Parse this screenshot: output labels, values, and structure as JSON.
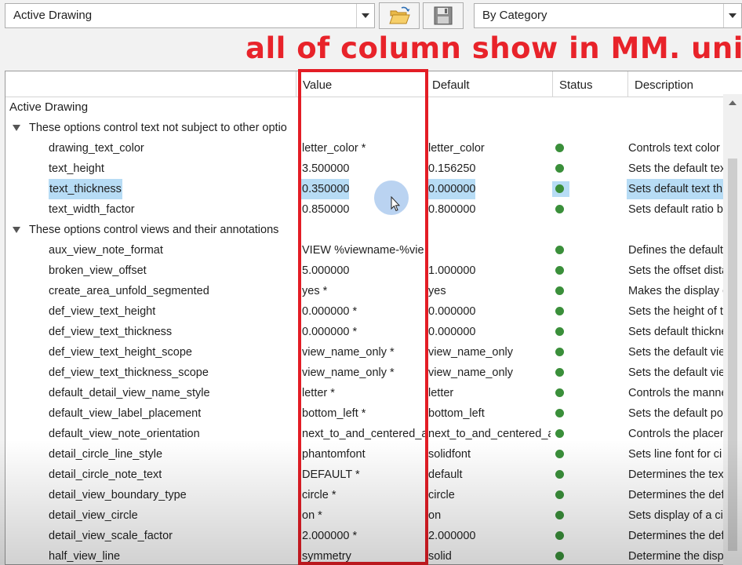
{
  "toolbar": {
    "drawing_select": "Active Drawing",
    "open_icon": "folder-open-icon",
    "save_icon": "save-icon",
    "filter_select": "By Category"
  },
  "annotation": "all of column show in MM. unit",
  "columns": {
    "value": "Value",
    "default": "Default",
    "status": "Status",
    "description": "Description"
  },
  "group_title": "Active Drawing",
  "colors": {
    "annotation": "#e8232a",
    "status_ok": "#3a8f3a",
    "selection": "#b7dcf5"
  },
  "rows": [
    {
      "kind": "category",
      "name": "These options control text not subject to other optio"
    },
    {
      "kind": "option",
      "name": "drawing_text_color",
      "value": "letter_color *",
      "default": "letter_color",
      "status": "ok",
      "description": "Controls text color"
    },
    {
      "kind": "option",
      "name": "text_height",
      "value": "3.500000",
      "default": "0.156250",
      "status": "ok",
      "description": "Sets the default tex"
    },
    {
      "kind": "option",
      "name": "text_thickness",
      "value": "0.350000",
      "default": "0.000000",
      "status": "ok",
      "description": "Sets default text th",
      "selected": true
    },
    {
      "kind": "option",
      "name": "text_width_factor",
      "value": "0.850000",
      "default": "0.800000",
      "status": "ok",
      "description": "Sets default ratio b"
    },
    {
      "kind": "category",
      "name": "These options control views and their annotations"
    },
    {
      "kind": "option",
      "name": "aux_view_note_format",
      "value": "VIEW %viewname-%vie",
      "default": "",
      "status": "ok",
      "description": "Defines the default"
    },
    {
      "kind": "option",
      "name": "broken_view_offset",
      "value": "5.000000",
      "default": "1.000000",
      "status": "ok",
      "description": "Sets the offset dista"
    },
    {
      "kind": "option",
      "name": "create_area_unfold_segmented",
      "value": "yes *",
      "default": "yes",
      "status": "ok",
      "description": "Makes the display o"
    },
    {
      "kind": "option",
      "name": "def_view_text_height",
      "value": "0.000000 *",
      "default": "0.000000",
      "status": "ok",
      "description": "Sets the height of t"
    },
    {
      "kind": "option",
      "name": "def_view_text_thickness",
      "value": "0.000000 *",
      "default": "0.000000",
      "status": "ok",
      "description": "Sets default thickne"
    },
    {
      "kind": "option",
      "name": "def_view_text_height_scope",
      "value": "view_name_only *",
      "default": "view_name_only",
      "status": "ok",
      "description": "Sets the default vie"
    },
    {
      "kind": "option",
      "name": "def_view_text_thickness_scope",
      "value": "view_name_only *",
      "default": "view_name_only",
      "status": "ok",
      "description": "Sets the default vie"
    },
    {
      "kind": "option",
      "name": "default_detail_view_name_style",
      "value": "letter *",
      "default": "letter",
      "status": "ok",
      "description": "Controls the manne"
    },
    {
      "kind": "option",
      "name": "default_view_label_placement",
      "value": "bottom_left *",
      "default": "bottom_left",
      "status": "ok",
      "description": "Sets the default po"
    },
    {
      "kind": "option",
      "name": "default_view_note_orientation",
      "value": "next_to_and_centered_a",
      "default": "next_to_and_centered_a",
      "status": "ok",
      "description": "Controls the placem"
    },
    {
      "kind": "option",
      "name": "detail_circle_line_style",
      "value": "phantomfont",
      "default": "solidfont",
      "status": "ok",
      "description": "Sets line font for ci"
    },
    {
      "kind": "option",
      "name": "detail_circle_note_text",
      "value": "DEFAULT *",
      "default": "default",
      "status": "ok",
      "description": "Determines the tex"
    },
    {
      "kind": "option",
      "name": "detail_view_boundary_type",
      "value": "circle *",
      "default": "circle",
      "status": "ok",
      "description": "Determines the def"
    },
    {
      "kind": "option",
      "name": "detail_view_circle",
      "value": "on *",
      "default": "on",
      "status": "ok",
      "description": "Sets display of a cir"
    },
    {
      "kind": "option",
      "name": "detail_view_scale_factor",
      "value": "2.000000 *",
      "default": "2.000000",
      "status": "ok",
      "description": "Determines the def"
    },
    {
      "kind": "option",
      "name": "half_view_line",
      "value": "symmetry",
      "default": "solid",
      "status": "ok",
      "description": "Determine the disp"
    }
  ]
}
